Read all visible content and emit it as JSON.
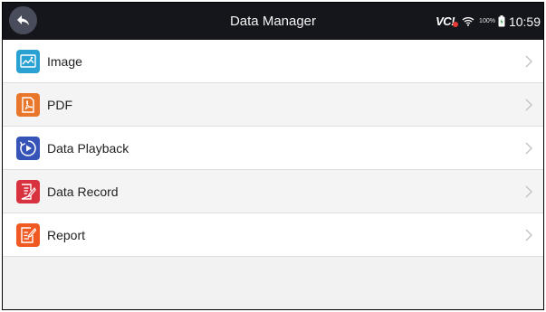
{
  "header": {
    "title": "Data Manager",
    "back_icon": "back-arrow-icon",
    "status": {
      "vci_label": "VC",
      "vci_mark": "!",
      "wifi_icon": "wifi-icon",
      "battery_pct": "100%",
      "battery_icon": "battery-icon",
      "time": "10:59"
    }
  },
  "menu": {
    "items": [
      {
        "label": "Image",
        "icon": "image-icon",
        "icon_color": "#2aa1d3"
      },
      {
        "label": "PDF",
        "icon": "pdf-icon",
        "icon_color": "#e8772b"
      },
      {
        "label": "Data Playback",
        "icon": "playback-icon",
        "icon_color": "#3653b8"
      },
      {
        "label": "Data Record",
        "icon": "record-icon",
        "icon_color": "#d9323f"
      },
      {
        "label": "Report",
        "icon": "report-icon",
        "icon_color": "#f05a22"
      }
    ],
    "chevron_icon": "chevron-right-icon"
  },
  "colors": {
    "topbar": "#15151c",
    "back_button": "#494c5a",
    "background": "#f2f2f2"
  }
}
